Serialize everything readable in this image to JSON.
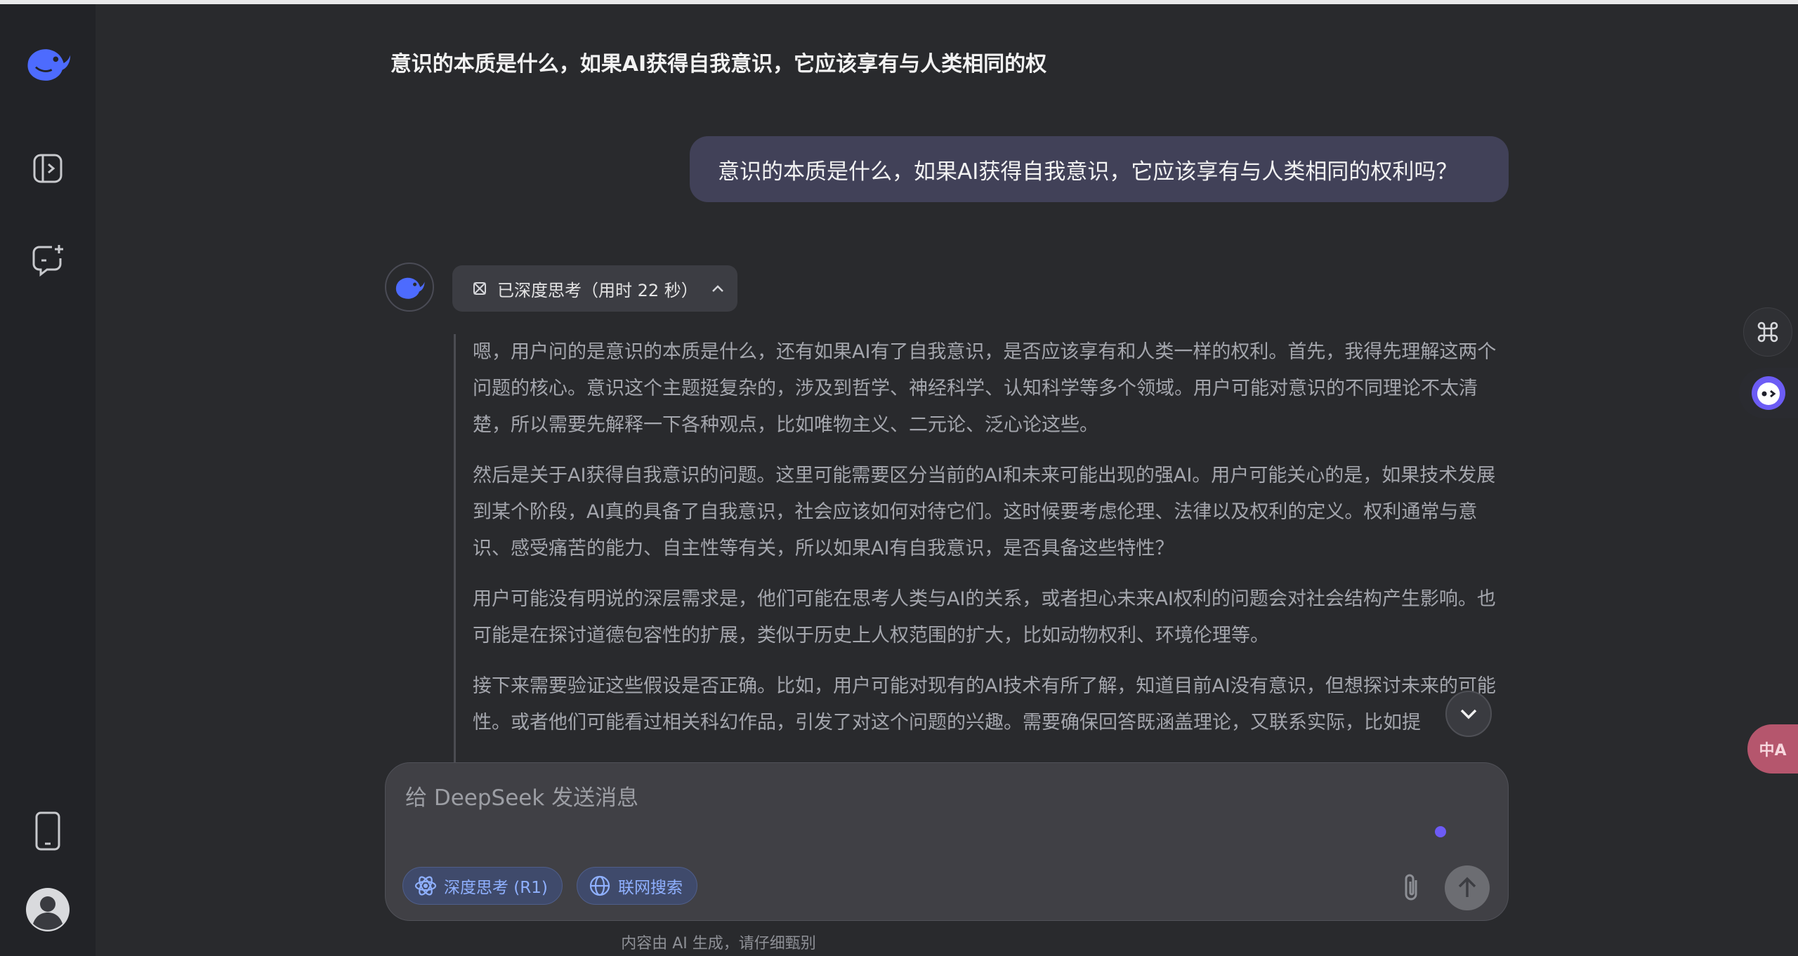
{
  "conversation": {
    "title": "意识的本质是什么，如果AI获得自我意识，它应该享有与人类相同的权"
  },
  "user_message": {
    "text": "意识的本质是什么，如果AI获得自我意识，它应该享有与人类相同的权利吗？"
  },
  "assistant": {
    "think_chip_label": "已深度思考（用时 22 秒）",
    "thought_paragraphs": [
      "嗯，用户问的是意识的本质是什么，还有如果AI有了自我意识，是否应该享有和人类一样的权利。首先，我得先理解这两个问题的核心。意识这个主题挺复杂的，涉及到哲学、神经科学、认知科学等多个领域。用户可能对意识的不同理论不太清楚，所以需要先解释一下各种观点，比如唯物主义、二元论、泛心论这些。",
      "然后是关于AI获得自我意识的问题。这里可能需要区分当前的AI和未来可能出现的强AI。用户可能关心的是，如果技术发展到某个阶段，AI真的具备了自我意识，社会应该如何对待它们。这时候要考虑伦理、法律以及权利的定义。权利通常与意识、感受痛苦的能力、自主性等有关，所以如果AI有自我意识，是否具备这些特性？",
      "用户可能没有明说的深层需求是，他们可能在思考人类与AI的关系，或者担心未来AI权利的问题会对社会结构产生影响。也可能是在探讨道德包容性的扩展，类似于历史上人权范围的扩大，比如动物权利、环境伦理等。",
      "接下来需要验证这些假设是否正确。比如，用户可能对现有的AI技术有所了解，知道目前AI没有意识，但想探讨未来的可能性。或者他们可能看过相关科幻作品，引发了对这个问题的兴趣。需要确保回答既涵盖理论，又联系实际，比如提"
    ]
  },
  "composer": {
    "placeholder": "给 DeepSeek 发送消息",
    "deep_think_label": "深度思考 (R1)",
    "web_search_label": "联网搜索"
  },
  "footer": {
    "disclaimer": "内容由 AI 生成，请仔细甄别"
  },
  "side_tools": {
    "translate_glyph": "中A"
  },
  "colors": {
    "accent": "#4d6bfe",
    "background": "#292a2d",
    "sidebar": "#222327",
    "user_bubble": "#414158"
  }
}
